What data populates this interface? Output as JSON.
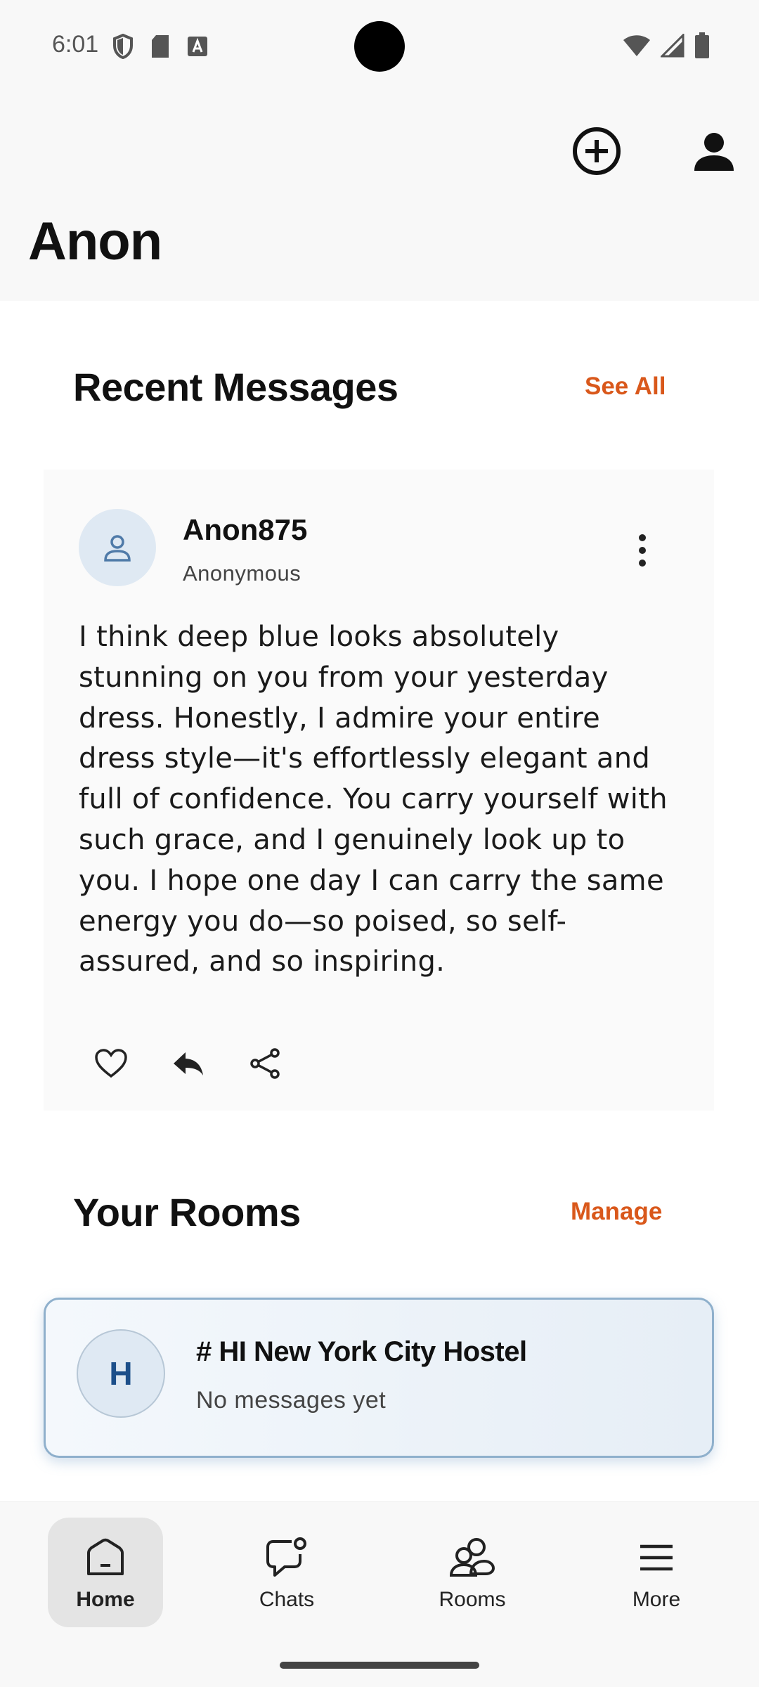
{
  "status_bar": {
    "time": "6:01",
    "left_icons": [
      "shield-icon",
      "sd-card-icon",
      "font-icon"
    ],
    "right_icons": [
      "wifi-icon",
      "signal-icon",
      "battery-icon"
    ]
  },
  "header": {
    "title": "Anon",
    "actions": [
      "add-circle-icon",
      "profile-icon"
    ]
  },
  "recent_messages": {
    "title": "Recent Messages",
    "see_all_label": "See All",
    "message": {
      "sender": "Anon875",
      "role": "Anonymous",
      "body": "I think deep blue looks absolutely stunning on you from your yesterday dress. Honestly, I admire your entire dress style—it's effortlessly elegant and full of confidence. You carry yourself with such grace, and I genuinely look up to you. I hope one day I can carry the same energy you do—so poised, so self-assured, and so inspiring.",
      "actions": [
        "heart-icon",
        "reply-icon",
        "share-icon"
      ]
    }
  },
  "rooms": {
    "title": "Your Rooms",
    "manage_label": "Manage",
    "items": [
      {
        "initial": "H",
        "name": "# HI New York City Hostel",
        "status": "No messages yet"
      }
    ]
  },
  "bottom_nav": {
    "items": [
      {
        "label": "Home",
        "icon": "home-icon",
        "active": true
      },
      {
        "label": "Chats",
        "icon": "chat-icon",
        "active": false
      },
      {
        "label": "Rooms",
        "icon": "rooms-icon",
        "active": false
      },
      {
        "label": "More",
        "icon": "menu-icon",
        "active": false
      }
    ]
  },
  "colors": {
    "accent": "#d9581b",
    "room_border": "#8fb0cc",
    "avatar_bg": "#dfe9f3"
  }
}
